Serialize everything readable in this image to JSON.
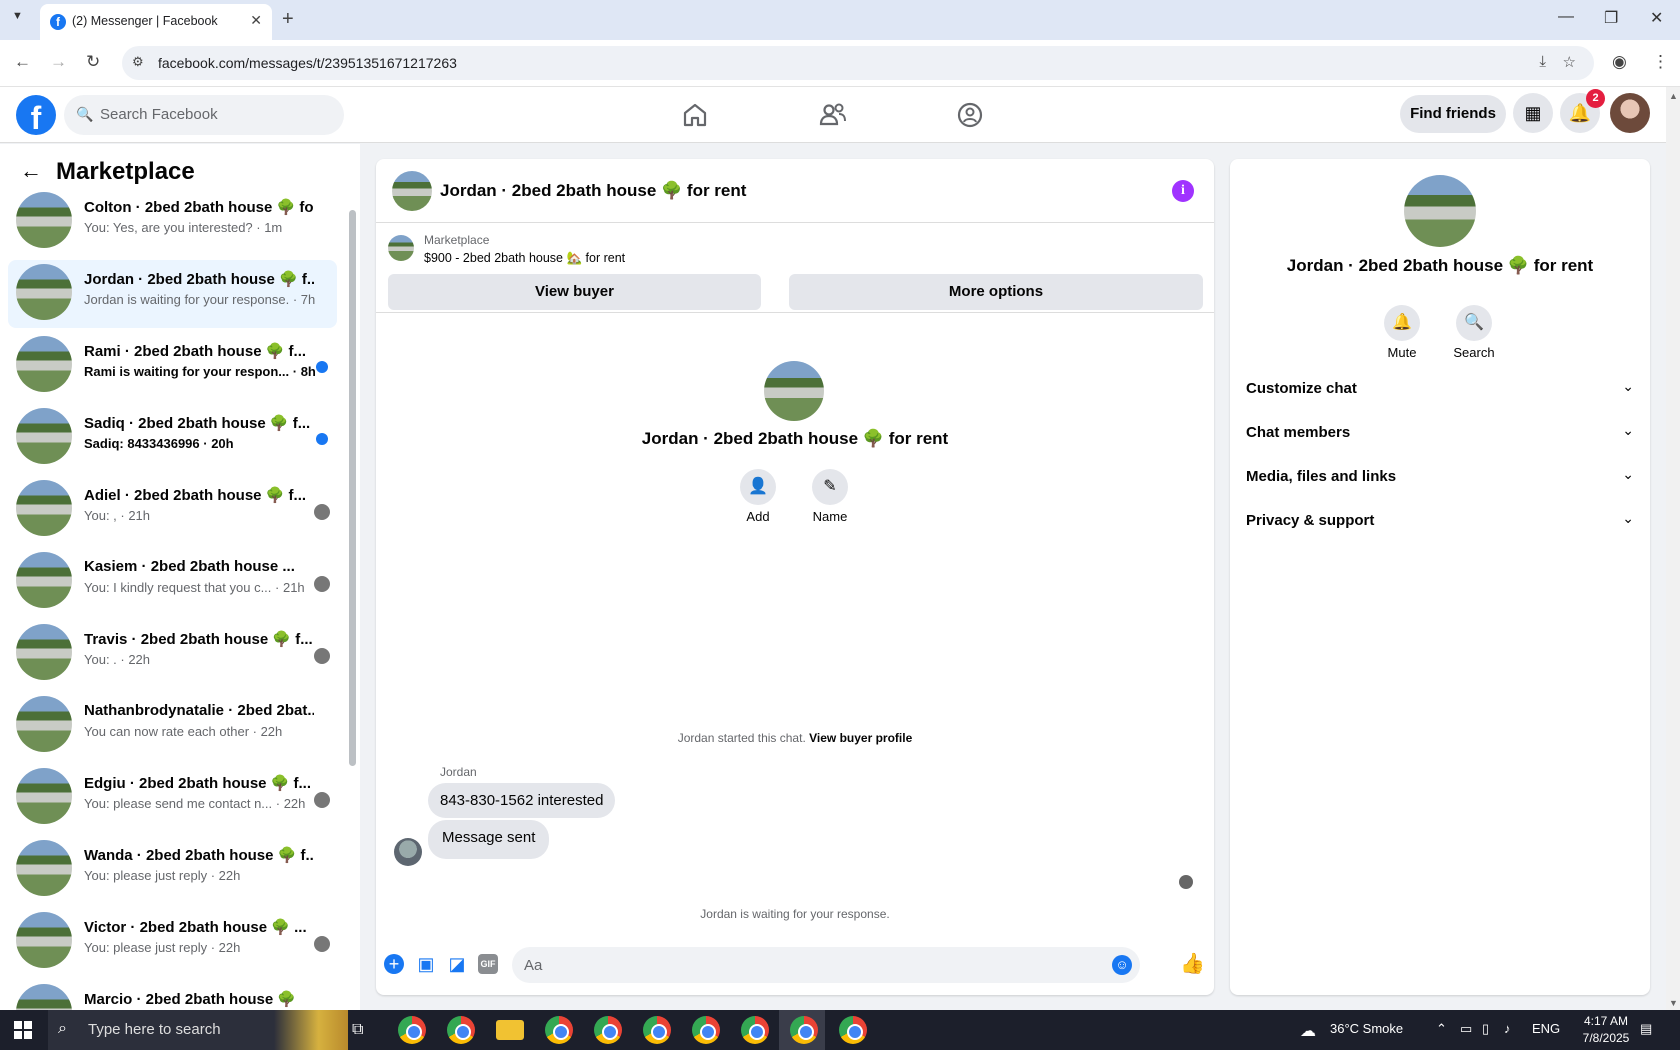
{
  "browser": {
    "tab_title": "(2) Messenger | Facebook",
    "url": "facebook.com/messages/t/23951351671217263"
  },
  "header": {
    "search_placeholder": "Search Facebook",
    "find_friends": "Find friends",
    "notif_count": "2"
  },
  "sidebar": {
    "title": "Marketplace",
    "conversations": [
      {
        "name": "Colton · 2bed 2bath house 🌳 fo...",
        "preview": "You: Yes, are you interested? · 1m",
        "unread": false,
        "active": false,
        "trailing": "none"
      },
      {
        "name": "Jordan · 2bed 2bath house 🌳 f...",
        "preview": "Jordan is waiting for your response. · 7h",
        "unread": false,
        "active": true,
        "trailing": "none"
      },
      {
        "name": "Rami · 2bed 2bath house 🌳 f...",
        "preview": "Rami is waiting for your respon... · 8h",
        "unread": true,
        "active": false,
        "trailing": "dot"
      },
      {
        "name": "Sadiq · 2bed 2bath house 🌳 f...",
        "preview": "Sadiq: 8433436996 · 20h",
        "unread": true,
        "active": false,
        "trailing": "dot"
      },
      {
        "name": "Adiel · 2bed 2bath house 🌳 f...",
        "preview": "You: , · 21h",
        "unread": false,
        "active": false,
        "trailing": "avatar"
      },
      {
        "name": "Kasiem · 2bed 2bath house ...",
        "preview": "You: I kindly request that you c... · 21h",
        "unread": false,
        "active": false,
        "trailing": "avatar"
      },
      {
        "name": "Travis · 2bed 2bath house 🌳 f...",
        "preview": "You: . · 22h",
        "unread": false,
        "active": false,
        "trailing": "avatar"
      },
      {
        "name": "Nathanbrodynatalie · 2bed 2bat...",
        "preview": "You can now rate each other · 22h",
        "unread": false,
        "active": false,
        "trailing": "none"
      },
      {
        "name": "Edgiu · 2bed 2bath house 🌳 f...",
        "preview": "You: please send me contact n... · 22h",
        "unread": false,
        "active": false,
        "trailing": "avatar"
      },
      {
        "name": "Wanda · 2bed 2bath house 🌳 f...",
        "preview": "You: please just reply · 22h",
        "unread": false,
        "active": false,
        "trailing": "none"
      },
      {
        "name": "Victor · 2bed 2bath house 🌳 ...",
        "preview": "You: please just reply · 22h",
        "unread": false,
        "active": false,
        "trailing": "avatar"
      },
      {
        "name": "Marcio · 2bed 2bath house 🌳",
        "preview": "",
        "unread": false,
        "active": false,
        "trailing": "none"
      }
    ]
  },
  "chat": {
    "title": "Jordan · 2bed 2bath house 🌳 for rent",
    "marketplace_label": "Marketplace",
    "listing": "$900 - 2bed 2bath house 🏡 for rent",
    "view_buyer": "View buyer",
    "more_options": "More options",
    "center_title": "Jordan · 2bed 2bath house 🌳 for rent",
    "add_label": "Add",
    "name_label": "Name",
    "started_text": "Jordan started this chat.",
    "view_buyer_profile": "View buyer profile",
    "sender": "Jordan",
    "messages": [
      "843-830-1562 interested",
      "Message sent"
    ],
    "waiting": "Jordan is waiting for your response.",
    "composer_placeholder": "Aa"
  },
  "details": {
    "title": "Jordan · 2bed 2bath house 🌳 for rent",
    "mute": "Mute",
    "search": "Search",
    "sections": [
      "Customize chat",
      "Chat members",
      "Media, files and links",
      "Privacy & support"
    ]
  },
  "taskbar": {
    "search_placeholder": "Type here to search",
    "weather": "36°C  Smoke",
    "lang": "ENG",
    "time": "4:17 AM",
    "date": "7/8/2025"
  },
  "colors": {
    "brand": "#1877f2",
    "active_row": "#ebf5ff",
    "info_icon": "#a033ff",
    "badge": "#e41e3f"
  }
}
